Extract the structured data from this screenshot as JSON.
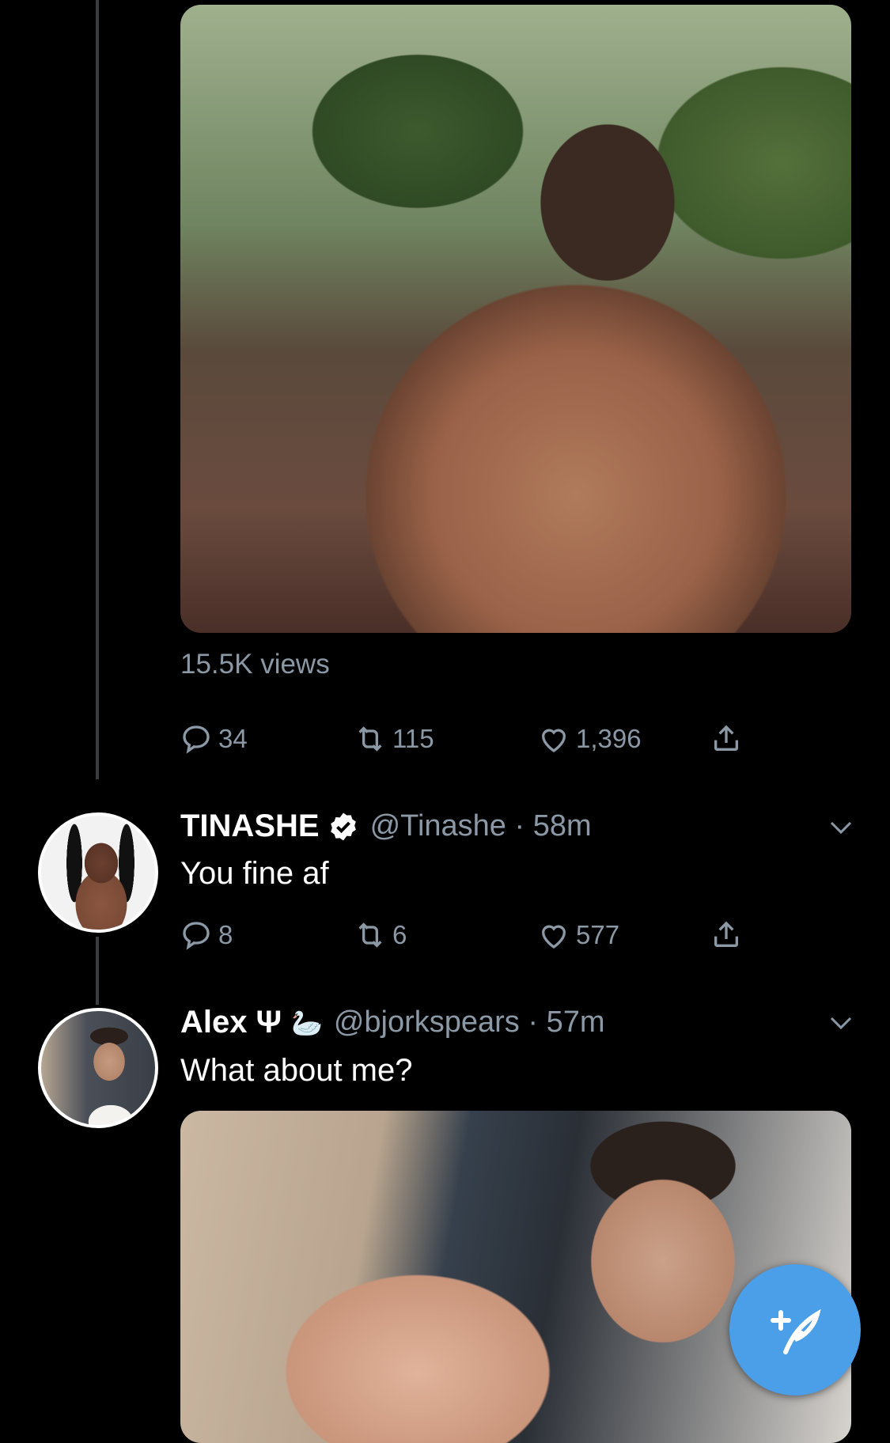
{
  "original_tweet": {
    "views_label": "15.5K views",
    "actions": {
      "replies": "34",
      "retweets": "115",
      "likes": "1,396"
    }
  },
  "replies": [
    {
      "display_name": "TINASHE",
      "verified": true,
      "handle_time": "@Tinashe · 58m",
      "text": "You fine af",
      "actions": {
        "replies": "8",
        "retweets": "6",
        "likes": "577"
      }
    },
    {
      "display_name": "Alex Ψ",
      "name_emoji": "🦢",
      "handle_time": "@bjorkspears · 57m",
      "text": "What about me?"
    }
  ],
  "colors": {
    "background": "#000000",
    "muted_text": "#8b98a5",
    "fab_blue": "#4b9ee8",
    "thread_line": "#3a3d42"
  },
  "icons": [
    "reply-icon",
    "retweet-icon",
    "like-icon",
    "share-icon",
    "verified-icon",
    "chevron-down-icon",
    "compose-tweet-icon"
  ]
}
